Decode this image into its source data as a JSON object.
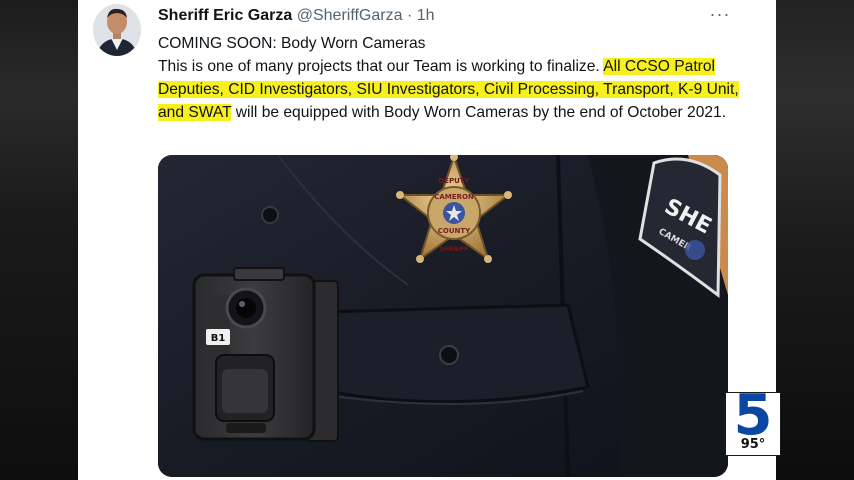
{
  "tweet": {
    "author_name": "Sheriff Eric Garza",
    "handle": "@SheriffGarza",
    "time_ago": "1h",
    "separator": "·",
    "more_icon": "···",
    "line_title": "COMING SOON:  Body Worn Cameras",
    "text_before_highlight": "This is one of many projects that our Team is working to finalize. ",
    "highlighted_text": "All CCSO Patrol Deputies, CID Investigators, SIU Investigators, Civil Processing, Transport, K-9 Unit, and SWAT",
    "text_after_highlight": " will be equipped with Body Worn Cameras by the end of October 2021."
  },
  "media": {
    "badge_top_text": "DEPUTY",
    "badge_middle_text": "CAMERON",
    "badge_bottom_text": "COUNTY",
    "badge_sub_text": "SHERIFF",
    "camera_label": "B1",
    "shoulder_patch_text": "SHE",
    "shoulder_patch_sub_text": "CAMER"
  },
  "overlay": {
    "channel_number": "5",
    "temperature": "95°",
    "brand_color": "#0a47a3"
  },
  "colors": {
    "highlight": "#f7f01d",
    "uniform": "#1a1d26"
  }
}
